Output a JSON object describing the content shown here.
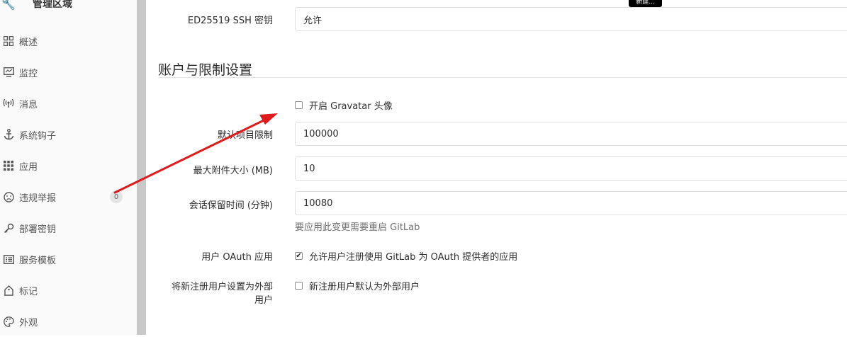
{
  "sidebar": {
    "header_title": "管理区域",
    "items": [
      {
        "label": "概述",
        "icon": "dashboard-icon"
      },
      {
        "label": "监控",
        "icon": "monitor-icon"
      },
      {
        "label": "消息",
        "icon": "broadcast-icon"
      },
      {
        "label": "系统钩子",
        "icon": "anchor-icon"
      },
      {
        "label": "应用",
        "icon": "apps-icon"
      },
      {
        "label": "违规举报",
        "icon": "abuse-icon",
        "count": "0"
      },
      {
        "label": "部署密钥",
        "icon": "key-icon"
      },
      {
        "label": "服务模板",
        "icon": "template-icon"
      },
      {
        "label": "标记",
        "icon": "label-icon"
      },
      {
        "label": "外观",
        "icon": "palette-icon"
      }
    ]
  },
  "tooltip": "新建...",
  "ssh": {
    "label": "ED25519 SSH 密钥",
    "value": "允许"
  },
  "section": {
    "title": "账户与限制设置"
  },
  "gravatar": {
    "label": "开启 Gravatar 头像",
    "checked": false
  },
  "project_limit": {
    "label": "默认项目限制",
    "value": "100000"
  },
  "attachment": {
    "label": "最大附件大小 (MB)",
    "value": "10"
  },
  "session": {
    "label": "会话保留时间 (分钟)",
    "value": "10080",
    "help": "要应用此变更需要重启 GitLab"
  },
  "oauth": {
    "label": "用户 OAuth 应用",
    "check_label": "允许用户注册使用 GitLab 为 OAuth 提供者的应用",
    "checked": true
  },
  "external": {
    "label_line1": "将新注册用户设置为外部",
    "label_line2": "用户",
    "check_label": "新注册用户默认为外部用户",
    "checked": false
  },
  "annotation": {
    "color": "#e01b1b"
  }
}
